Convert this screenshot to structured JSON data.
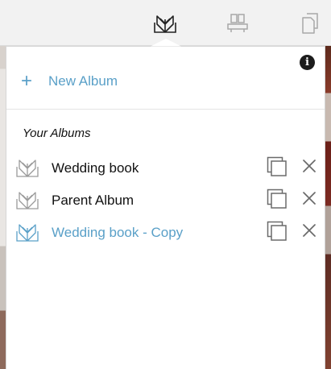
{
  "toolbar": {
    "icons": [
      "album-book-icon",
      "page-spread-icon",
      "pages-stack-icon"
    ]
  },
  "popover": {
    "info_icon": "info-icon",
    "info_glyph": "i",
    "new_album": {
      "icon": "plus-icon",
      "glyph": "+",
      "label": "New Album"
    },
    "section_title": "Your Albums",
    "albums": [
      {
        "name": "Wedding book",
        "active": false
      },
      {
        "name": "Parent Album",
        "active": false
      },
      {
        "name": "Wedding book - Copy",
        "active": true
      }
    ]
  },
  "colors": {
    "accent": "#5aa0c8",
    "text": "#111111",
    "icon_gray": "#9a9a9a",
    "toolbar_bg": "#f2f2f2"
  }
}
